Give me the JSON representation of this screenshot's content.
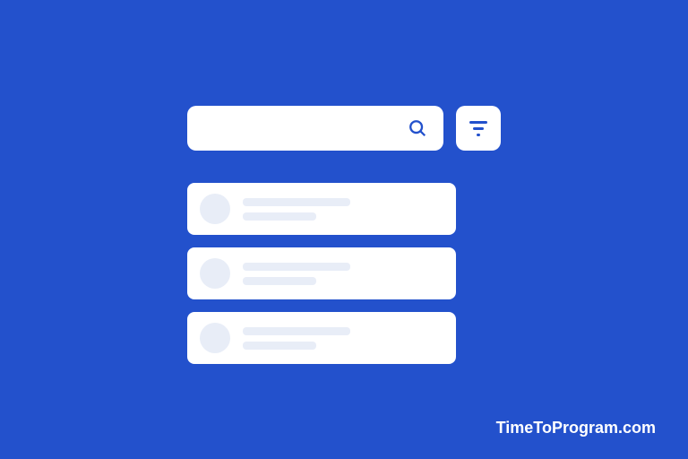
{
  "search": {
    "value": "",
    "placeholder": ""
  },
  "results": [
    {
      "id": 1
    },
    {
      "id": 2
    },
    {
      "id": 3
    }
  ],
  "watermark": "TimeToProgram.com",
  "colors": {
    "background": "#2351cc",
    "card": "#ffffff",
    "placeholder": "#e8edf7",
    "accent": "#2351cc"
  }
}
